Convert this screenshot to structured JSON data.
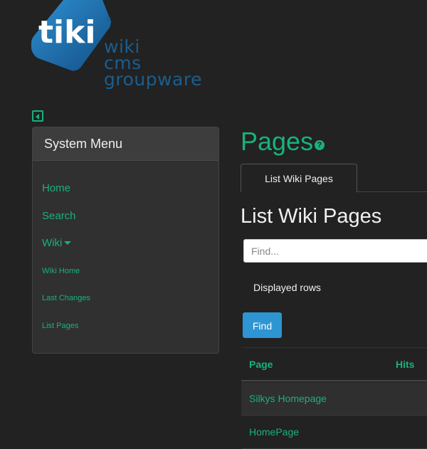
{
  "logo": {
    "badge_text": "tiki",
    "registered": "®",
    "lines": [
      "wiki",
      "cms",
      "groupware"
    ]
  },
  "sidebar": {
    "title": "System Menu",
    "items": [
      {
        "label": "Home"
      },
      {
        "label": "Search"
      },
      {
        "label": "Wiki"
      },
      {
        "label": "Wiki Home"
      },
      {
        "label": "Last Changes"
      },
      {
        "label": "List Pages"
      }
    ]
  },
  "main": {
    "title": "Pages",
    "help_icon": "question-circle-icon",
    "tabs": [
      {
        "label": "List Wiki Pages"
      }
    ],
    "section_title": "List Wiki Pages",
    "find": {
      "placeholder": "Find...",
      "value": "",
      "displayed_rows_label": "Displayed rows",
      "button_label": "Find"
    },
    "table": {
      "headers": {
        "page": "Page",
        "hits": "Hits"
      },
      "rows": [
        {
          "page": "Silkys Homepage"
        },
        {
          "page": "HomePage"
        }
      ]
    }
  },
  "colors": {
    "background": "#222222",
    "accent": "#18b27a",
    "button": "#2e95d3",
    "logo_blue": "#1b5e8e"
  }
}
